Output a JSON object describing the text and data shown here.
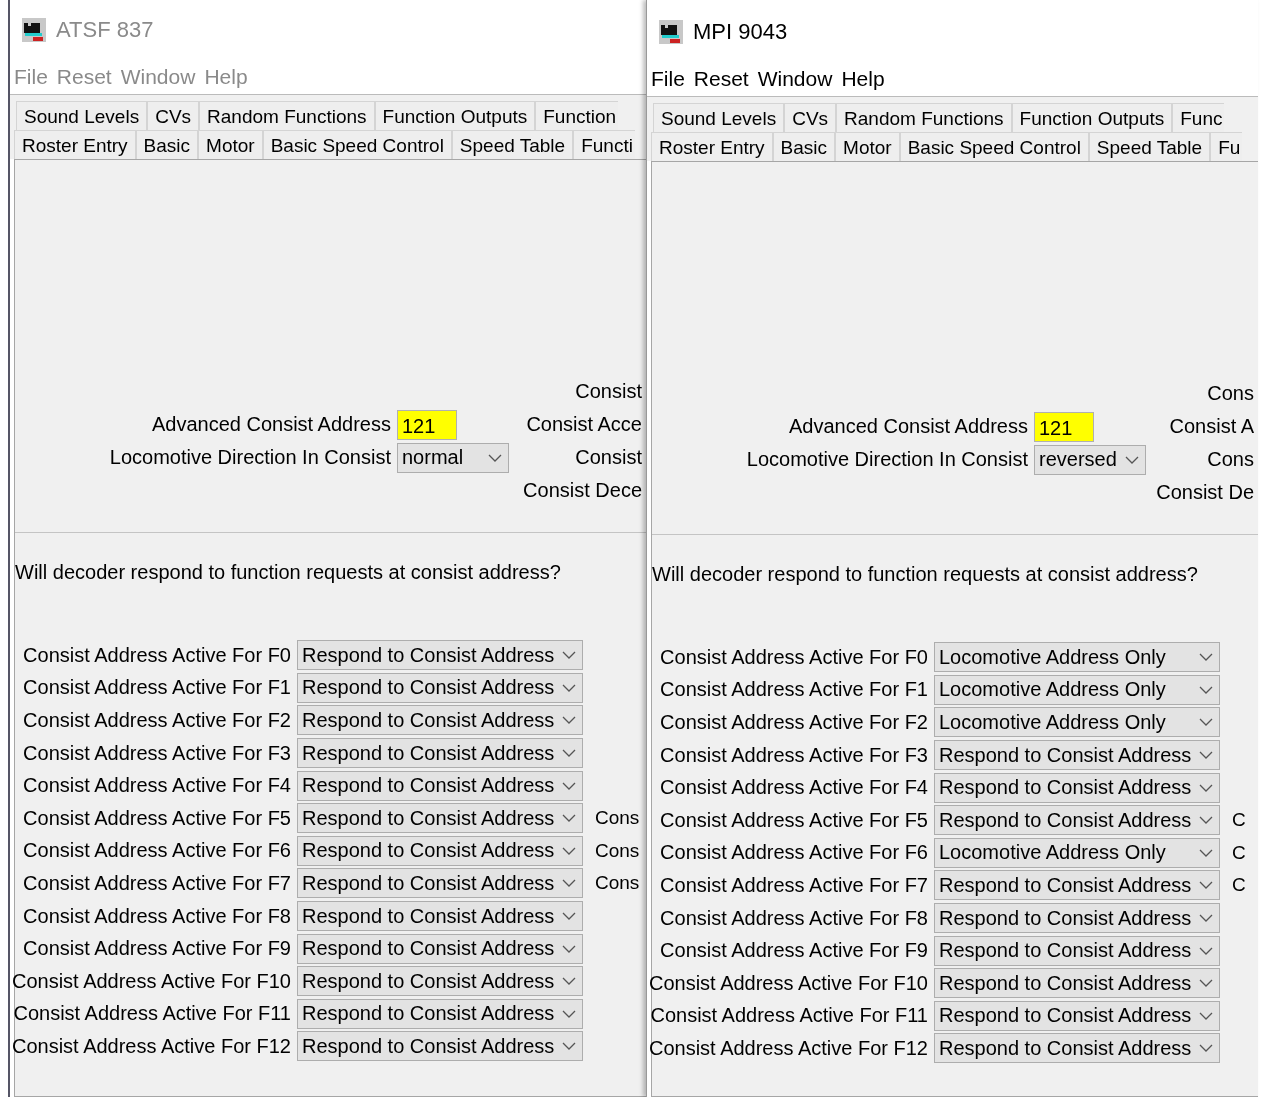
{
  "windows": [
    {
      "title": "ATSF 837",
      "active": false,
      "menu": [
        "File",
        "Reset",
        "Window",
        "Help"
      ],
      "tab_rows": [
        [
          "Sound Levels",
          "CVs",
          "Random Functions",
          "Function Outputs",
          "Function"
        ],
        [
          "Roster Entry",
          "Basic",
          "Motor",
          "Basic Speed Control",
          "Speed Table",
          "Functi"
        ]
      ],
      "consist": {
        "side_labels": [
          "Consist",
          "Consist Acce",
          "Consist",
          "Consist Dece"
        ],
        "address_label": "Advanced Consist Address",
        "address": "121",
        "direction_label": "Locomotive Direction In Consist",
        "direction": "normal"
      },
      "question": "Will decoder respond to function requests at consist address?",
      "functions": [
        {
          "label": "Consist Address Active For F0",
          "value": "Respond to Consist Address"
        },
        {
          "label": "Consist Address Active For F1",
          "value": "Respond to Consist Address"
        },
        {
          "label": "Consist Address Active For F2",
          "value": "Respond to Consist Address"
        },
        {
          "label": "Consist Address Active For F3",
          "value": "Respond to Consist Address"
        },
        {
          "label": "Consist Address Active For F4",
          "value": "Respond to Consist Address"
        },
        {
          "label": "Consist Address Active For F5",
          "value": "Respond to Consist Address",
          "side": "Cons"
        },
        {
          "label": "Consist Address Active For F6",
          "value": "Respond to Consist Address",
          "side": "Cons"
        },
        {
          "label": "Consist Address Active For F7",
          "value": "Respond to Consist Address",
          "side": "Cons"
        },
        {
          "label": "Consist Address Active For F8",
          "value": "Respond to Consist Address"
        },
        {
          "label": "Consist Address Active For F9",
          "value": "Respond to Consist Address"
        },
        {
          "label": "Consist Address Active For F10",
          "value": "Respond to Consist Address"
        },
        {
          "label": "Consist Address Active For F11",
          "value": "Respond to Consist Address"
        },
        {
          "label": "Consist Address Active For F12",
          "value": "Respond to Consist Address"
        }
      ]
    },
    {
      "title": "MPI 9043",
      "active": true,
      "menu": [
        "File",
        "Reset",
        "Window",
        "Help"
      ],
      "tab_rows": [
        [
          "Sound Levels",
          "CVs",
          "Random Functions",
          "Function Outputs",
          "Func"
        ],
        [
          "Roster Entry",
          "Basic",
          "Motor",
          "Basic Speed Control",
          "Speed Table",
          "Fu"
        ]
      ],
      "consist": {
        "side_labels": [
          "Cons",
          "Consist A",
          "Cons",
          "Consist De"
        ],
        "address_label": "Advanced Consist Address",
        "address": "121",
        "direction_label": "Locomotive Direction In Consist",
        "direction": "reversed"
      },
      "question": "Will decoder respond to function requests at consist address?",
      "functions": [
        {
          "label": "Consist Address Active For F0",
          "value": "Locomotive Address Only"
        },
        {
          "label": "Consist Address Active For F1",
          "value": "Locomotive Address Only"
        },
        {
          "label": "Consist Address Active For F2",
          "value": "Locomotive Address Only"
        },
        {
          "label": "Consist Address Active For F3",
          "value": "Respond to Consist Address"
        },
        {
          "label": "Consist Address Active For F4",
          "value": "Respond to Consist Address"
        },
        {
          "label": "Consist Address Active For F5",
          "value": "Respond to Consist Address",
          "side": "C"
        },
        {
          "label": "Consist Address Active For F6",
          "value": "Locomotive Address Only",
          "side": "C"
        },
        {
          "label": "Consist Address Active For F7",
          "value": "Respond to Consist Address",
          "side": "C"
        },
        {
          "label": "Consist Address Active For F8",
          "value": "Respond to Consist Address"
        },
        {
          "label": "Consist Address Active For F9",
          "value": "Respond to Consist Address"
        },
        {
          "label": "Consist Address Active For F10",
          "value": "Respond to Consist Address"
        },
        {
          "label": "Consist Address Active For F11",
          "value": "Respond to Consist Address"
        },
        {
          "label": "Consist Address Active For F12",
          "value": "Respond to Consist Address"
        }
      ]
    }
  ]
}
